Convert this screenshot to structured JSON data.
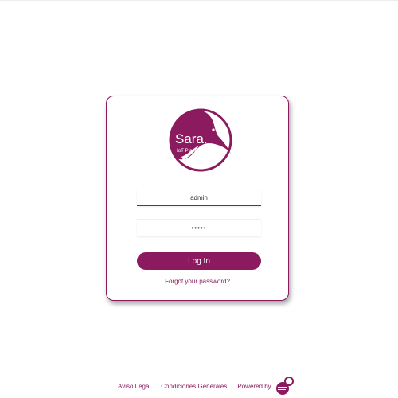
{
  "brand": {
    "name": "Sara.",
    "tagline": "IoT Platform",
    "color": "#8c1a5e"
  },
  "login": {
    "username_value": "admin",
    "password_value": "•••••",
    "button_label": "Log In",
    "forgot_link": "Forgot your password?"
  },
  "footer": {
    "legal": "Aviso Legal",
    "conditions": "Condiciones Generales",
    "powered_by": "Powered by",
    "powered_logo_icon": "minsait-logo-icon"
  }
}
